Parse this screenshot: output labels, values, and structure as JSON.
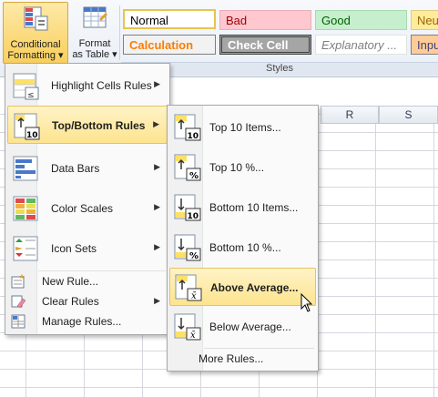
{
  "ribbon": {
    "conditional_formatting": {
      "line1": "Conditional",
      "line2": "Formatting",
      "arrow": "▾"
    },
    "format_as_table": {
      "line1": "Format",
      "line2": "as Table",
      "arrow": "▾"
    },
    "styles_group_label": "Styles",
    "styles": [
      {
        "label": "Normal",
        "bg": "#ffffff",
        "color": "#000000"
      },
      {
        "label": "Bad",
        "bg": "#ffc7ce",
        "color": "#9c0006"
      },
      {
        "label": "Good",
        "bg": "#c6efce",
        "color": "#006100"
      },
      {
        "label": "Neu",
        "bg": "#ffeb9c",
        "color": "#9c6500"
      },
      {
        "label": "Calculation",
        "bg": "#f2f2f2",
        "color": "#fa7d00"
      },
      {
        "label": "Check Cell",
        "bg": "#a5a5a5",
        "color": "#ffffff"
      },
      {
        "label": "Explanatory ...",
        "bg": "#ffffff",
        "color": "#7f7f7f"
      },
      {
        "label": "Inpu",
        "bg": "#ffcc99",
        "color": "#3f3f76"
      }
    ]
  },
  "grid": {
    "columns": [
      "R",
      "S"
    ]
  },
  "cf_menu": {
    "items": [
      {
        "label": "Highlight Cells Rules",
        "icon": "highlight-cells-rules-icon"
      },
      {
        "label": "Top/Bottom Rules",
        "icon": "top-bottom-rules-icon"
      },
      {
        "label": "Data Bars",
        "icon": "data-bars-icon"
      },
      {
        "label": "Color Scales",
        "icon": "color-scales-icon"
      },
      {
        "label": "Icon Sets",
        "icon": "icon-sets-icon"
      }
    ],
    "small_items": [
      {
        "label": "New Rule...",
        "icon": "new-rule-icon"
      },
      {
        "label": "Clear Rules",
        "icon": "clear-rules-icon"
      },
      {
        "label": "Manage Rules...",
        "icon": "manage-rules-icon"
      }
    ],
    "submenu_arrow": "▶"
  },
  "topbottom_menu": {
    "items": [
      {
        "label": "Top 10 Items...",
        "badge": "10"
      },
      {
        "label": "Top 10 %...",
        "badge": "%"
      },
      {
        "label": "Bottom 10 Items...",
        "badge": "10"
      },
      {
        "label": "Bottom 10 %...",
        "badge": "%"
      },
      {
        "label": "Above Average...",
        "badge": "x̄"
      },
      {
        "label": "Below Average...",
        "badge": "x̄"
      }
    ],
    "more_rules": "More Rules..."
  },
  "colors": {
    "highlight": "#fde48f",
    "menu_border": "#a8a8a8"
  }
}
